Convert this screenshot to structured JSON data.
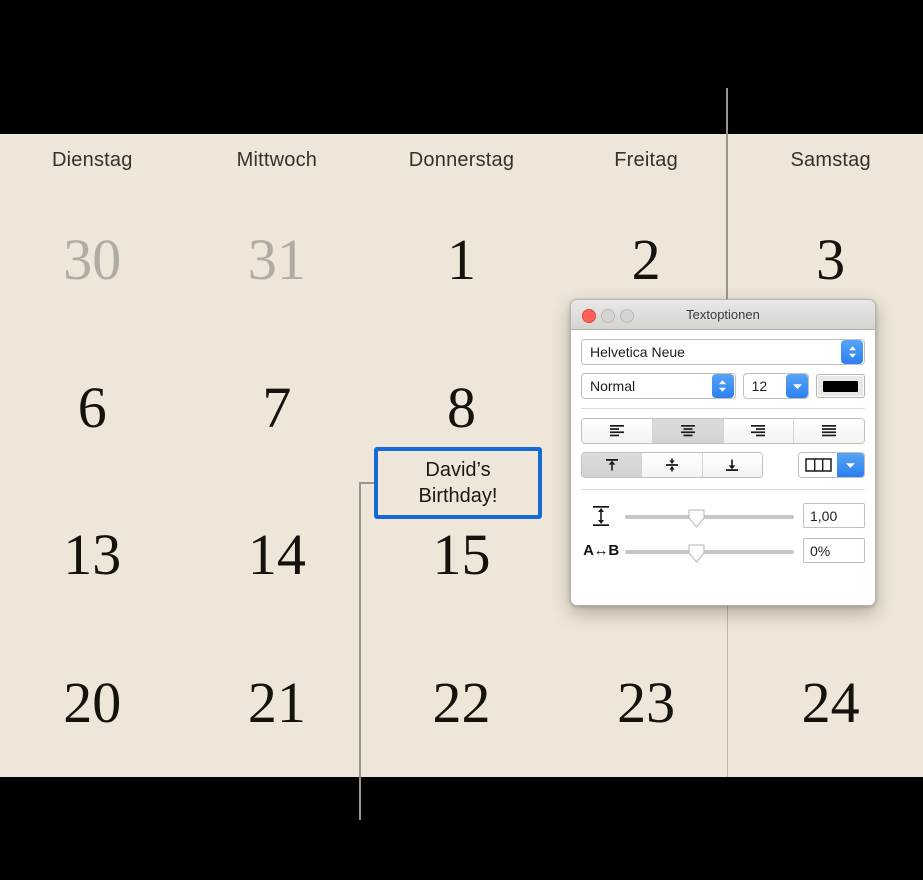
{
  "calendar": {
    "day_names": [
      "Dienstag",
      "Mittwoch",
      "Donnerstag",
      "Freitag",
      "Samstag"
    ],
    "weeks": [
      [
        {
          "num": "30",
          "muted": true
        },
        {
          "num": "31",
          "muted": true
        },
        {
          "num": "1",
          "muted": false
        },
        {
          "num": "2",
          "muted": false
        },
        {
          "num": "3",
          "muted": false
        }
      ],
      [
        {
          "num": "6",
          "muted": false
        },
        {
          "num": "7",
          "muted": false
        },
        {
          "num": "8",
          "muted": false
        },
        {
          "num": "",
          "muted": false
        },
        {
          "num": "",
          "muted": false
        }
      ],
      [
        {
          "num": "13",
          "muted": false
        },
        {
          "num": "14",
          "muted": false
        },
        {
          "num": "15",
          "muted": false
        },
        {
          "num": "",
          "muted": false
        },
        {
          "num": "",
          "muted": false
        }
      ],
      [
        {
          "num": "20",
          "muted": false
        },
        {
          "num": "21",
          "muted": false
        },
        {
          "num": "22",
          "muted": false
        },
        {
          "num": "23",
          "muted": false
        },
        {
          "num": "24",
          "muted": false
        }
      ]
    ],
    "callout": {
      "line1": "David’s",
      "line2": "Birthday!",
      "border_color": "#1769D6"
    },
    "background_color": "#EDE6D9"
  },
  "text_options_window": {
    "title": "Textoptionen",
    "traffic_lights": {
      "close_color": "#FF6159",
      "minimize_color": "#D6D4D1",
      "zoom_color": "#D6D4D1"
    },
    "font_family": {
      "value": "Helvetica Neue"
    },
    "font_style": {
      "value": "Normal"
    },
    "font_size": {
      "value": "12"
    },
    "text_color": {
      "value": "#000000"
    },
    "horizontal_align": {
      "options": [
        "align-left",
        "align-center",
        "align-right",
        "align-justify"
      ],
      "selected_index": 1
    },
    "vertical_align": {
      "options": [
        "align-top",
        "align-middle",
        "align-bottom"
      ],
      "selected_index": 0
    },
    "columns": {
      "icon": "columns-icon"
    },
    "line_spacing": {
      "icon": "line-spacing-icon",
      "value": "1,00",
      "slider_percent": 42
    },
    "character_spacing": {
      "icon": "character-spacing-icon",
      "label": "A↔B",
      "value": "0%",
      "slider_percent": 42
    },
    "accent_color": "#2D7FF0"
  }
}
